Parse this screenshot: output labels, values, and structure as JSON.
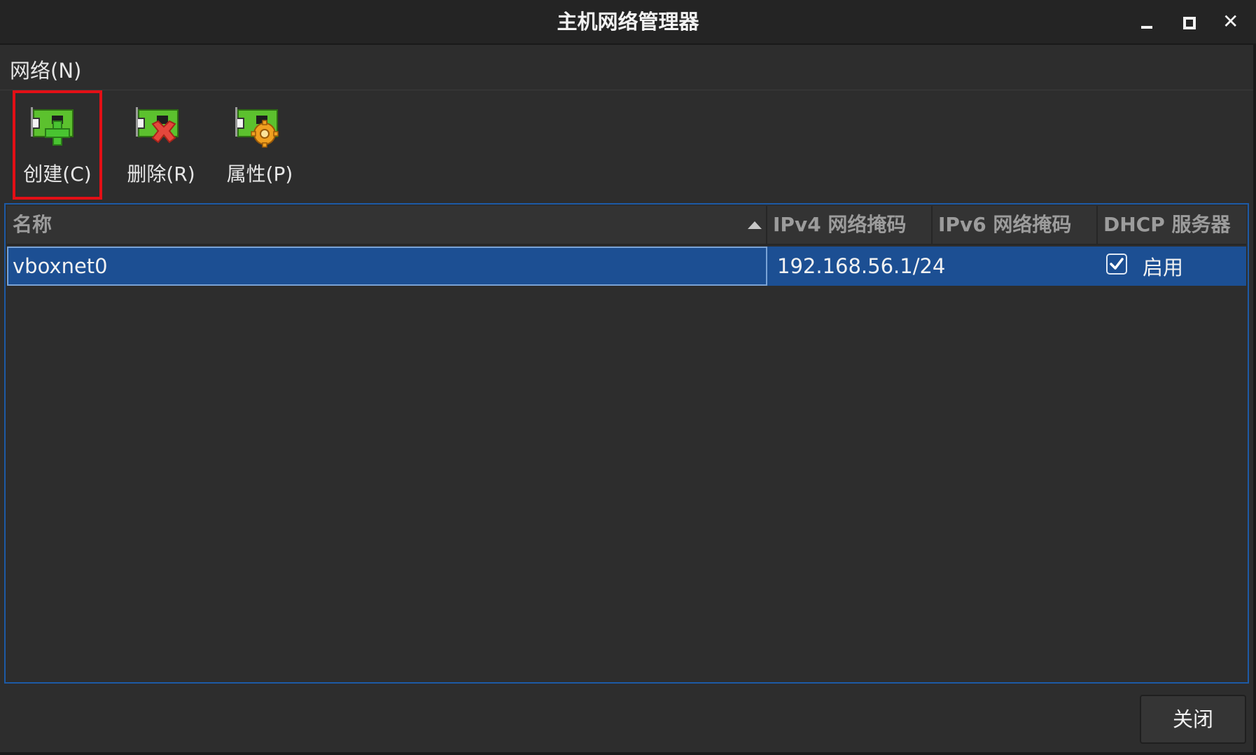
{
  "window": {
    "title": "主机网络管理器",
    "controls": {
      "minimize": "minimize-icon",
      "maximize": "maximize-icon",
      "close": "close-icon"
    }
  },
  "menu": {
    "items": [
      {
        "label": "网络(N)"
      }
    ]
  },
  "toolbar": {
    "create_label": "创建(C)",
    "delete_label": "删除(R)",
    "properties_label": "属性(P)",
    "create_icon": "network-add-icon",
    "delete_icon": "network-remove-icon",
    "properties_icon": "network-settings-icon",
    "highlight_color": "#e30f16"
  },
  "table": {
    "columns": [
      {
        "label": "名称",
        "sorted": "ascending"
      },
      {
        "label": "IPv4 网络掩码"
      },
      {
        "label": "IPv6 网络掩码"
      },
      {
        "label": "DHCP 服务器"
      }
    ],
    "rows": [
      {
        "name": "vboxnet0",
        "ipv4": "192.168.56.1/24",
        "ipv6": "",
        "dhcp_enabled": true,
        "dhcp_label": "启用",
        "selected": true
      }
    ],
    "selection_color": "#1c4f93",
    "frame_color": "#1d5aa6"
  },
  "footer": {
    "close_label": "关闭"
  }
}
